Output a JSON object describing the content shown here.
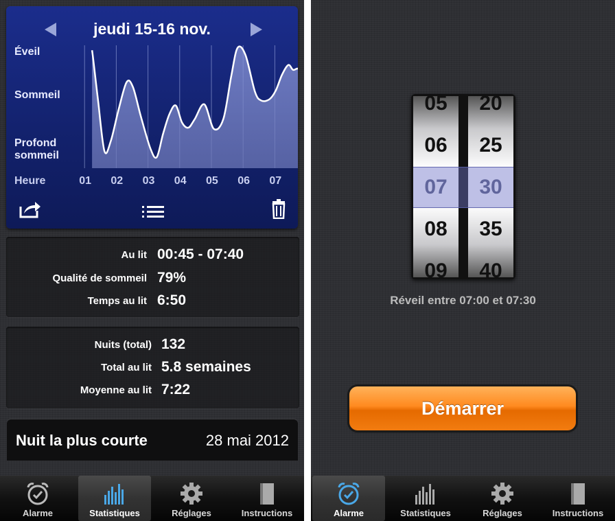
{
  "left": {
    "chart": {
      "title": "jeudi 15-16 nov.",
      "y_labels": [
        "Éveil",
        "Sommeil",
        "Profond\nsommeil"
      ],
      "x_title": "Heure",
      "x_labels": [
        "01",
        "02",
        "03",
        "04",
        "05",
        "06",
        "07"
      ]
    },
    "chart_data": {
      "type": "area",
      "title": "jeudi 15-16 nov.",
      "xlabel": "Heure",
      "ylabel": "",
      "x_ticks": [
        "01",
        "02",
        "03",
        "04",
        "05",
        "06",
        "07"
      ],
      "y_categories": [
        "Profond sommeil",
        "Sommeil",
        "Éveil"
      ],
      "ylim": [
        0,
        100
      ],
      "series": [
        {
          "x": [
            0.76,
            0.8,
            0.95,
            1.15,
            1.35,
            1.6,
            1.85,
            2.05,
            2.3,
            2.6,
            2.8,
            3.0,
            3.2,
            3.4,
            3.6,
            3.8,
            4.0,
            4.3,
            4.6,
            4.9,
            5.15,
            5.35,
            5.6,
            5.9,
            6.1,
            6.35,
            6.55,
            6.75,
            6.95,
            7.1,
            7.25,
            7.4,
            7.6
          ],
          "y": [
            96,
            88,
            55,
            14,
            22,
            48,
            70,
            66,
            42,
            16,
            9,
            28,
            44,
            51,
            37,
            33,
            40,
            52,
            32,
            40,
            75,
            98,
            92,
            62,
            55,
            56,
            63,
            76,
            84,
            80,
            81,
            77,
            77
          ]
        }
      ]
    },
    "stats1": [
      {
        "label": "Au lit",
        "value": "00:45 - 07:40"
      },
      {
        "label": "Qualité de sommeil",
        "value": "79%"
      },
      {
        "label": "Temps au lit",
        "value": "6:50"
      }
    ],
    "stats2": [
      {
        "label": "Nuits (total)",
        "value": "132"
      },
      {
        "label": "Total au lit",
        "value": "5.8 semaines"
      },
      {
        "label": "Moyenne au lit",
        "value": "7:22"
      }
    ],
    "shortest": {
      "title": "Nuit la plus courte",
      "date": "28 mai 2012"
    },
    "tabs": [
      {
        "label": "Alarme",
        "icon": "alarm-clock-icon"
      },
      {
        "label": "Statistiques",
        "icon": "bar-chart-icon"
      },
      {
        "label": "Réglages",
        "icon": "gear-icon"
      },
      {
        "label": "Instructions",
        "icon": "book-icon"
      }
    ],
    "selected_tab": "Statistiques"
  },
  "right": {
    "picker": {
      "hours": [
        "05",
        "06",
        "07",
        "08",
        "09"
      ],
      "minutes": [
        "20",
        "25",
        "30",
        "35",
        "40"
      ],
      "selected_hour": "07",
      "selected_minute": "30"
    },
    "hint": "Réveil entre 07:00 et 07:30",
    "start_label": "Démarrer",
    "tabs": [
      {
        "label": "Alarme",
        "icon": "alarm-clock-icon"
      },
      {
        "label": "Statistiques",
        "icon": "bar-chart-icon"
      },
      {
        "label": "Réglages",
        "icon": "gear-icon"
      },
      {
        "label": "Instructions",
        "icon": "book-icon"
      }
    ],
    "selected_tab": "Alarme"
  },
  "colors": {
    "chart_bg": "#13226e",
    "accent_button": "#ff8a1f",
    "alarm_icon_selected": "#4aa8e8"
  }
}
